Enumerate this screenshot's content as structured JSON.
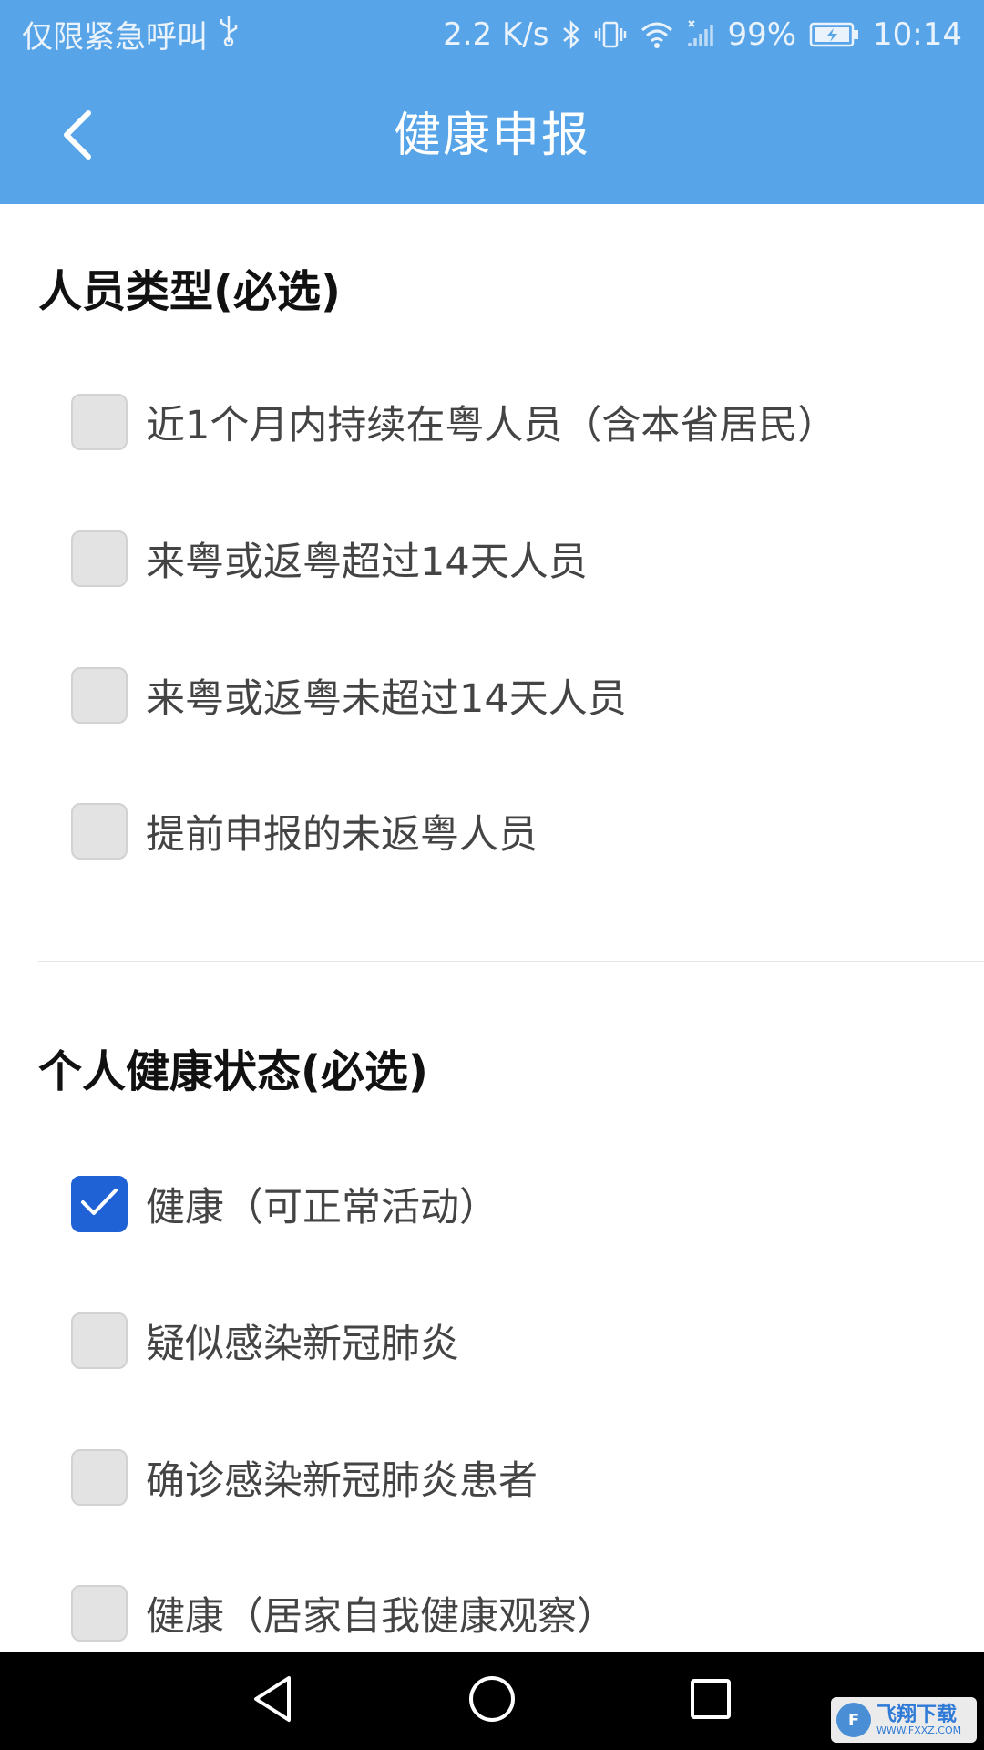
{
  "status_bar": {
    "left_text": "仅限紧急呼叫",
    "net_speed": "2.2 K/s",
    "battery": "99%",
    "time": "10:14",
    "icons": [
      "usb-icon",
      "bluetooth-icon",
      "vibrate-icon",
      "wifi-icon",
      "signal-icon",
      "battery-icon"
    ]
  },
  "app_bar": {
    "title": "健康申报",
    "back_icon": "chevron-left-icon"
  },
  "sections": {
    "person_type": {
      "title": "人员类型(必选)",
      "options": [
        {
          "label": "近1个月内持续在粤人员（含本省居民）",
          "checked": false
        },
        {
          "label": "来粤或返粤超过14天人员",
          "checked": false
        },
        {
          "label": "来粤或返粤未超过14天人员",
          "checked": false
        },
        {
          "label": "提前申报的未返粤人员",
          "checked": false
        }
      ]
    },
    "health_status": {
      "title": "个人健康状态(必选)",
      "options": [
        {
          "label": "健康（可正常活动）",
          "checked": true
        },
        {
          "label": "疑似感染新冠肺炎",
          "checked": false
        },
        {
          "label": "确诊感染新冠肺炎患者",
          "checked": false
        },
        {
          "label": "健康（居家自我健康观察）",
          "checked": false
        }
      ]
    }
  },
  "nav_bar": {
    "icons": [
      "back-triangle-icon",
      "home-circle-icon",
      "recents-square-icon"
    ]
  },
  "watermark": {
    "cn": "飞翔下载",
    "en": "WWW.FXXZ.COM"
  },
  "colors": {
    "header": "#57A5E8",
    "checked": "#1F62D6",
    "unchecked": "#E3E3E3"
  }
}
